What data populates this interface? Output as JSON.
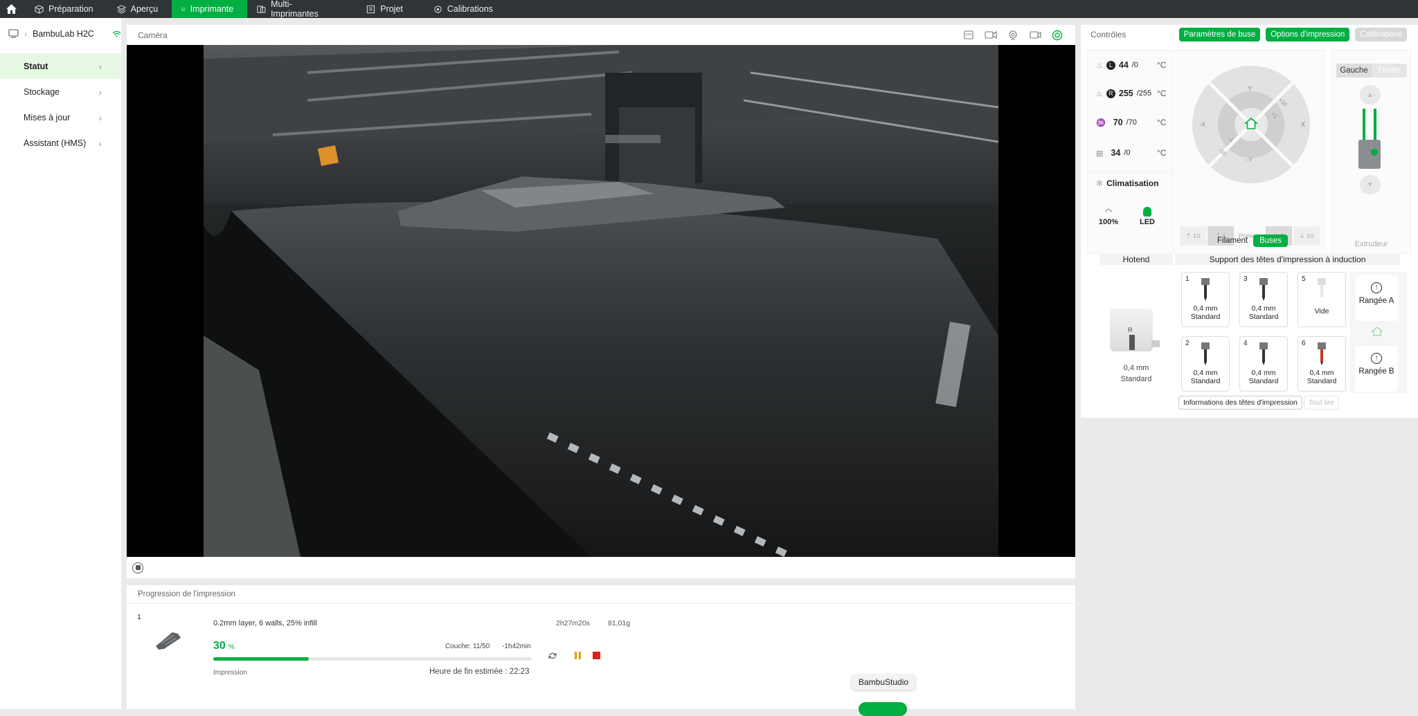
{
  "topbar": {
    "tabs": [
      {
        "label": "Préparation",
        "icon": "cube-icon"
      },
      {
        "label": "Aperçu",
        "icon": "layers-icon"
      },
      {
        "label": "Imprimante",
        "icon": "device-icon"
      },
      {
        "label": "Multi-Imprimantes",
        "icon": "multi-device-icon"
      },
      {
        "label": "Projet",
        "icon": "project-icon"
      },
      {
        "label": "Calibrations",
        "icon": "calibration-icon"
      }
    ],
    "active_tab": "Imprimante"
  },
  "sidebar": {
    "printer_name": "BambuLab H2C",
    "items": [
      {
        "label": "Statut"
      },
      {
        "label": "Stockage"
      },
      {
        "label": "Mises à jour"
      },
      {
        "label": "Assistant (HMS)"
      }
    ]
  },
  "camera": {
    "title": "Caméra",
    "overlay_text": "BambuStudio"
  },
  "progress": {
    "title": "Progression de l'impression",
    "plate_number": "1",
    "profile": "0.2mm layer, 6 walls, 25% infill",
    "duration": "2h27m20s",
    "weight": "81,01g",
    "percent": "30",
    "percent_unit": "%",
    "percent_value": 0.3,
    "layer": "Couche: 11/50",
    "remaining": "-1h42min",
    "status": "Impression",
    "eta": "Heure de fin estimée : 22:23"
  },
  "controls": {
    "title": "Contrôles",
    "btn_nozzle": "Paramètres de buse",
    "btn_print_options": "Options d'impression",
    "btn_calibrations": "Calibrations",
    "temps": [
      {
        "badge": "L",
        "current": "44",
        "target": "/0",
        "unit": "°C"
      },
      {
        "badge": "R",
        "current": "255",
        "target": "/255",
        "unit": "°C"
      },
      {
        "badge": "",
        "current": "70",
        "target": "/70",
        "unit": "°C"
      },
      {
        "badge": "",
        "current": "34",
        "target": "/0",
        "unit": "°C"
      }
    ],
    "climatisation": "Climatisation",
    "speed": "100%",
    "led": "LED",
    "jog": {
      "y_plus": "Y",
      "y_minus": "-Y",
      "x_minus": "-X",
      "x_plus": "X",
      "plus10": "+10",
      "plus1": "+1",
      "minus1": "-1",
      "minus10": "-10"
    },
    "bed_buttons": [
      "10",
      "1",
      "Plateau",
      "1",
      "10"
    ],
    "extruder_seg_left": "Gauche",
    "extruder_seg_right": "Droite",
    "extruder_label": "Extrudeur",
    "toggle_filament": "Filament",
    "toggle_buses": "Buses",
    "hotend_title": "Hotend",
    "hotend_letter": "R",
    "hotend_size": "0,4 mm",
    "hotend_type": "Standard",
    "rack_title": "Support des têtes d'impression à induction",
    "nozzles": [
      {
        "n": "1",
        "size": "0,4 mm",
        "type": "Standard"
      },
      {
        "n": "3",
        "size": "0,4 mm",
        "type": "Standard"
      },
      {
        "n": "5",
        "size": "",
        "type": "Vide"
      },
      {
        "n": "2",
        "size": "0,4 mm",
        "type": "Standard"
      },
      {
        "n": "4",
        "size": "0,4 mm",
        "type": "Standard"
      },
      {
        "n": "6",
        "size": "0,4 mm",
        "type": "Standard"
      }
    ],
    "row_a": "Rangée A",
    "row_b": "Rangée B",
    "btn_info": "Informations des têtes d'impression",
    "btn_read_all": "Tout lire"
  },
  "colors": {
    "accent": "#00ae42",
    "topbar": "#2f3436",
    "stop": "#e02020",
    "pause": "#f39800"
  }
}
